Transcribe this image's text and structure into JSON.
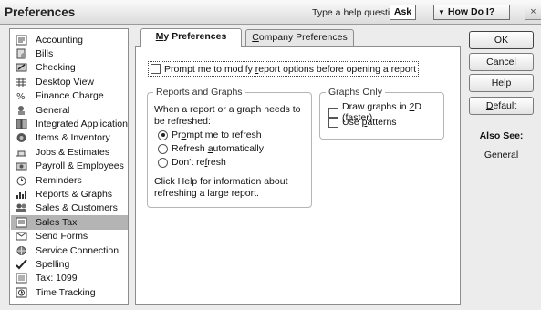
{
  "window": {
    "title": "Preferences",
    "help_prompt": "Type a help question",
    "help_ask": "Ask",
    "how_do_i": "How Do I?",
    "close_glyph": "×"
  },
  "sidebar": {
    "selected_index": 13,
    "items": [
      {
        "label": "Accounting",
        "icon": "accounting-icon"
      },
      {
        "label": "Bills",
        "icon": "bills-icon"
      },
      {
        "label": "Checking",
        "icon": "checking-icon"
      },
      {
        "label": "Desktop View",
        "icon": "desktop-view-icon"
      },
      {
        "label": "Finance Charge",
        "icon": "finance-charge-icon"
      },
      {
        "label": "General",
        "icon": "general-icon"
      },
      {
        "label": "Integrated Applications",
        "icon": "integrated-applications-icon"
      },
      {
        "label": "Items & Inventory",
        "icon": "items-inventory-icon"
      },
      {
        "label": "Jobs & Estimates",
        "icon": "jobs-estimates-icon"
      },
      {
        "label": "Payroll & Employees",
        "icon": "payroll-employees-icon"
      },
      {
        "label": "Reminders",
        "icon": "reminders-icon"
      },
      {
        "label": "Reports & Graphs",
        "icon": "reports-graphs-icon"
      },
      {
        "label": "Sales & Customers",
        "icon": "sales-customers-icon"
      },
      {
        "label": "Sales Tax",
        "icon": "sales-tax-icon"
      },
      {
        "label": "Send Forms",
        "icon": "send-forms-icon"
      },
      {
        "label": "Service Connection",
        "icon": "service-connection-icon"
      },
      {
        "label": "Spelling",
        "icon": "spelling-icon"
      },
      {
        "label": "Tax: 1099",
        "icon": "tax-1099-icon"
      },
      {
        "label": "Time Tracking",
        "icon": "time-tracking-icon"
      }
    ]
  },
  "tabs": {
    "my_prefix": "M",
    "my_rest": "y Preferences",
    "company_prefix": "C",
    "company_rest": "ompany Preferences"
  },
  "panel": {
    "prompt_modify_checkbox": {
      "label_pre": "Prompt me to modify ",
      "label_u": "r",
      "label_post": "eport options before opening a report",
      "checked": false
    },
    "reports_graphs": {
      "title": "Reports and Graphs",
      "question_line1": "When a report or a graph needs to",
      "question_line2": "be refreshed:",
      "radios": [
        {
          "pre": "Pr",
          "u": "o",
          "post": "mpt me to refresh",
          "checked": true
        },
        {
          "pre": "Refresh ",
          "u": "a",
          "post": "utomatically",
          "checked": false
        },
        {
          "pre": "Don't re",
          "u": "f",
          "post": "resh",
          "checked": false
        }
      ],
      "help_line1": "Click Help for information about",
      "help_line2": "refreshing a large report."
    },
    "graphs_only": {
      "title": "Graphs Only",
      "draw_2d": {
        "pre": "Draw graphs in ",
        "u": "2",
        "post": "D (faster)",
        "checked": false
      },
      "use_patterns": {
        "pre": "Use ",
        "u": "p",
        "post": "atterns",
        "checked": false
      }
    }
  },
  "buttons": {
    "ok": "OK",
    "cancel": "Cancel",
    "help": "Help",
    "default_u": "D",
    "default_rest": "efault"
  },
  "also_see": {
    "title": "Also See:",
    "link": "General"
  }
}
